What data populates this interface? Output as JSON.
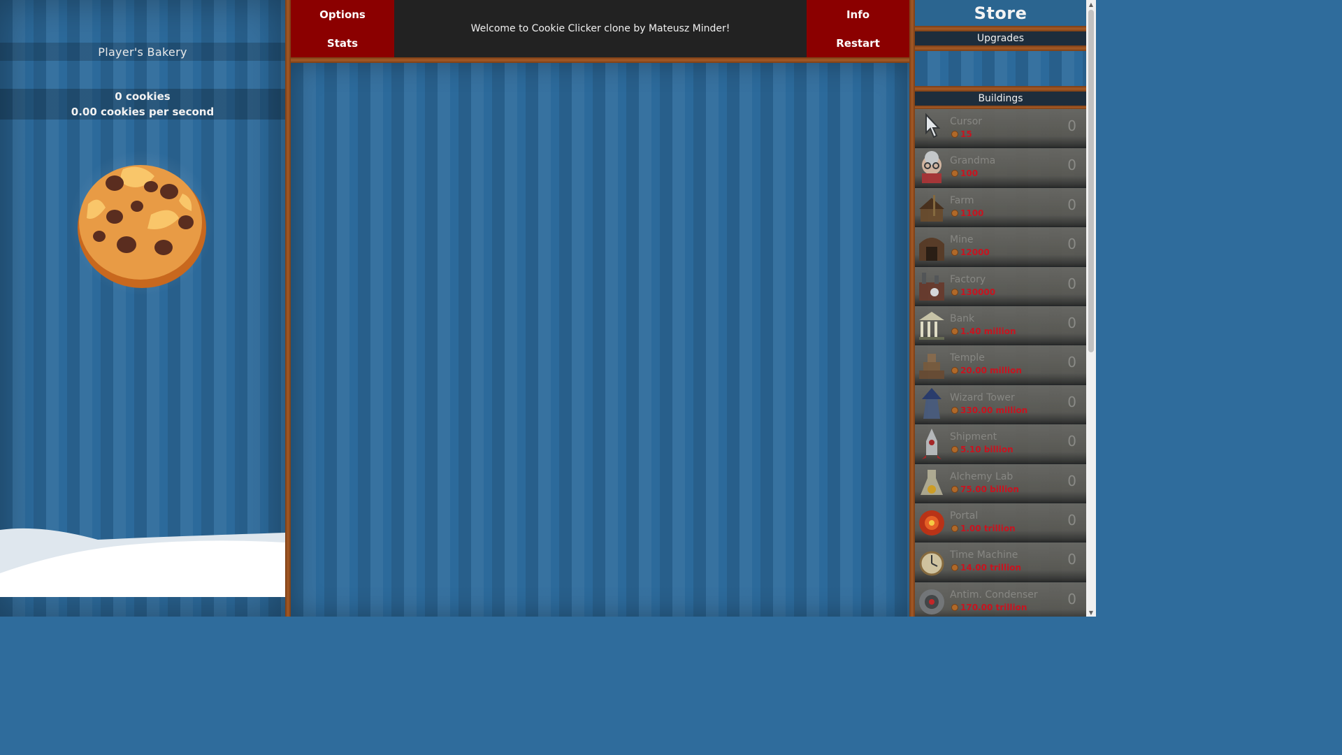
{
  "left_panel": {
    "bakery_name": "Player's Bakery",
    "cookies": "0 cookies",
    "cps": "0.00 cookies per second"
  },
  "top_bar": {
    "options_label": "Options",
    "stats_label": "Stats",
    "info_label": "Info",
    "restart_label": "Restart",
    "welcome_message": "Welcome to Cookie Clicker clone by Mateusz Minder!"
  },
  "store": {
    "title": "Store",
    "upgrades_label": "Upgrades",
    "buildings_label": "Buildings",
    "buildings": [
      {
        "name": "Cursor",
        "price": "15",
        "count": "0",
        "icon": "cursor-icon"
      },
      {
        "name": "Grandma",
        "price": "100",
        "count": "0",
        "icon": "grandma-icon"
      },
      {
        "name": "Farm",
        "price": "1100",
        "count": "0",
        "icon": "farm-icon"
      },
      {
        "name": "Mine",
        "price": "12000",
        "count": "0",
        "icon": "mine-icon"
      },
      {
        "name": "Factory",
        "price": "130000",
        "count": "0",
        "icon": "factory-icon"
      },
      {
        "name": "Bank",
        "price": "1.40 million",
        "count": "0",
        "icon": "bank-icon"
      },
      {
        "name": "Temple",
        "price": "20.00 million",
        "count": "0",
        "icon": "temple-icon"
      },
      {
        "name": "Wizard Tower",
        "price": "330.00 million",
        "count": "0",
        "icon": "wizard-tower-icon"
      },
      {
        "name": "Shipment",
        "price": "5.10 billion",
        "count": "0",
        "icon": "shipment-icon"
      },
      {
        "name": "Alchemy Lab",
        "price": "75.00 billion",
        "count": "0",
        "icon": "alchemy-lab-icon"
      },
      {
        "name": "Portal",
        "price": "1.00 trillion",
        "count": "0",
        "icon": "portal-icon"
      },
      {
        "name": "Time Machine",
        "price": "14.00 trillion",
        "count": "0",
        "icon": "time-machine-icon"
      },
      {
        "name": "Antim. Condenser",
        "price": "170.00 trillion",
        "count": "0",
        "icon": "antimatter-condenser-icon"
      }
    ]
  },
  "colors": {
    "background": "#2c6a9b",
    "menu_button": "#8b0000",
    "divider": "#a55a26",
    "price": "#d0101a"
  }
}
